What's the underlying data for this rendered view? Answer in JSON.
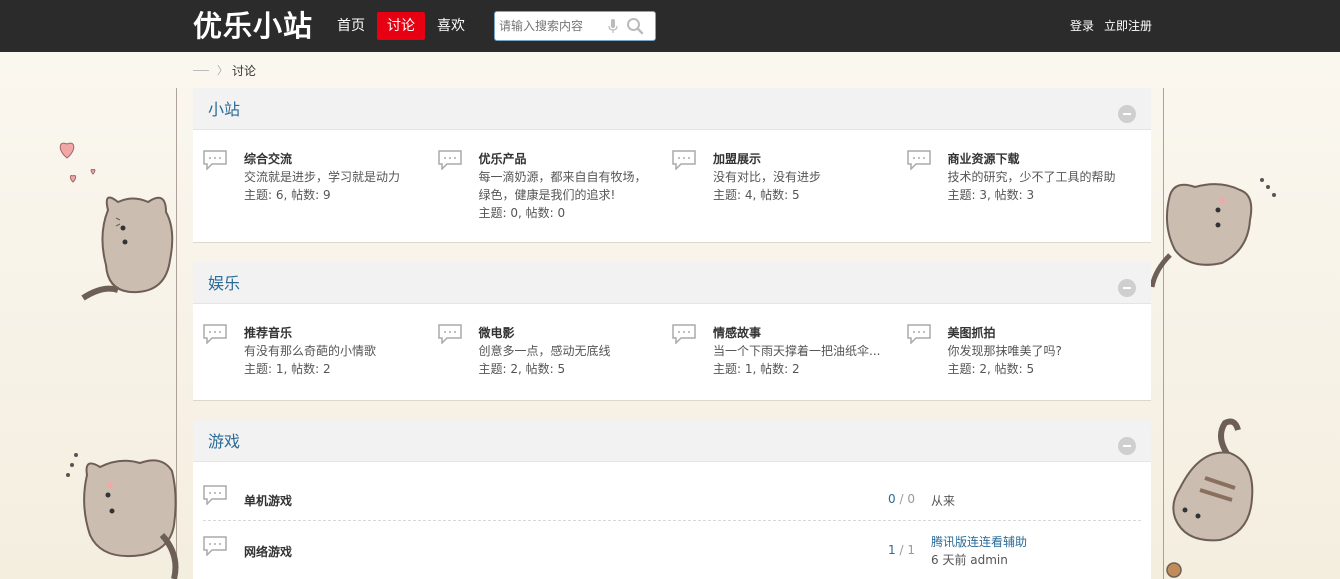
{
  "header": {
    "logo": "优乐小站",
    "nav": [
      "首页",
      "讨论",
      "喜欢"
    ],
    "active_nav": 1,
    "search_placeholder": "请输入搜索内容",
    "login": "登录",
    "register": "立即注册"
  },
  "breadcrumb": {
    "current": "讨论"
  },
  "sections": [
    {
      "title": "小站",
      "forums": [
        {
          "name": "综合交流",
          "desc": "交流就是进步，学习就是动力",
          "stats": "主题: 6, 帖数: 9"
        },
        {
          "name": "优乐产品",
          "desc": "每一滴奶源，都来自自有牧场，绿色，健康是我们的追求!",
          "stats": "主题: 0, 帖数: 0"
        },
        {
          "name": "加盟展示",
          "desc": "没有对比，没有进步",
          "stats": "主题: 4, 帖数: 5"
        },
        {
          "name": "商业资源下载",
          "desc": "技术的研究，少不了工具的帮助",
          "stats": "主题: 3, 帖数: 3"
        }
      ]
    },
    {
      "title": "娱乐",
      "forums": [
        {
          "name": "推荐音乐",
          "desc": "有没有那么奇葩的小情歌",
          "stats": "主题: 1, 帖数: 2"
        },
        {
          "name": "微电影",
          "desc": "创意多一点，感动无底线",
          "stats": "主题: 2, 帖数: 5"
        },
        {
          "name": "情感故事",
          "desc": "当一个下雨天撑着一把油纸伞...",
          "stats": "主题: 1, 帖数: 2"
        },
        {
          "name": "美图抓拍",
          "desc": "你发现那抹唯美了吗?",
          "stats": "主题: 2, 帖数: 5"
        }
      ]
    },
    {
      "title": "游戏",
      "rows": [
        {
          "name": "单机游戏",
          "threads": "0",
          "posts": "0",
          "last": "从来"
        },
        {
          "name": "网络游戏",
          "threads": "1",
          "posts": "1",
          "last_title": "腾讯版连连看辅助",
          "last_meta": "6 天前 admin"
        }
      ]
    }
  ],
  "colors": {
    "topbar": "#2b2b2b",
    "active_nav": "#e60012",
    "section_title": "#2b6b96"
  }
}
